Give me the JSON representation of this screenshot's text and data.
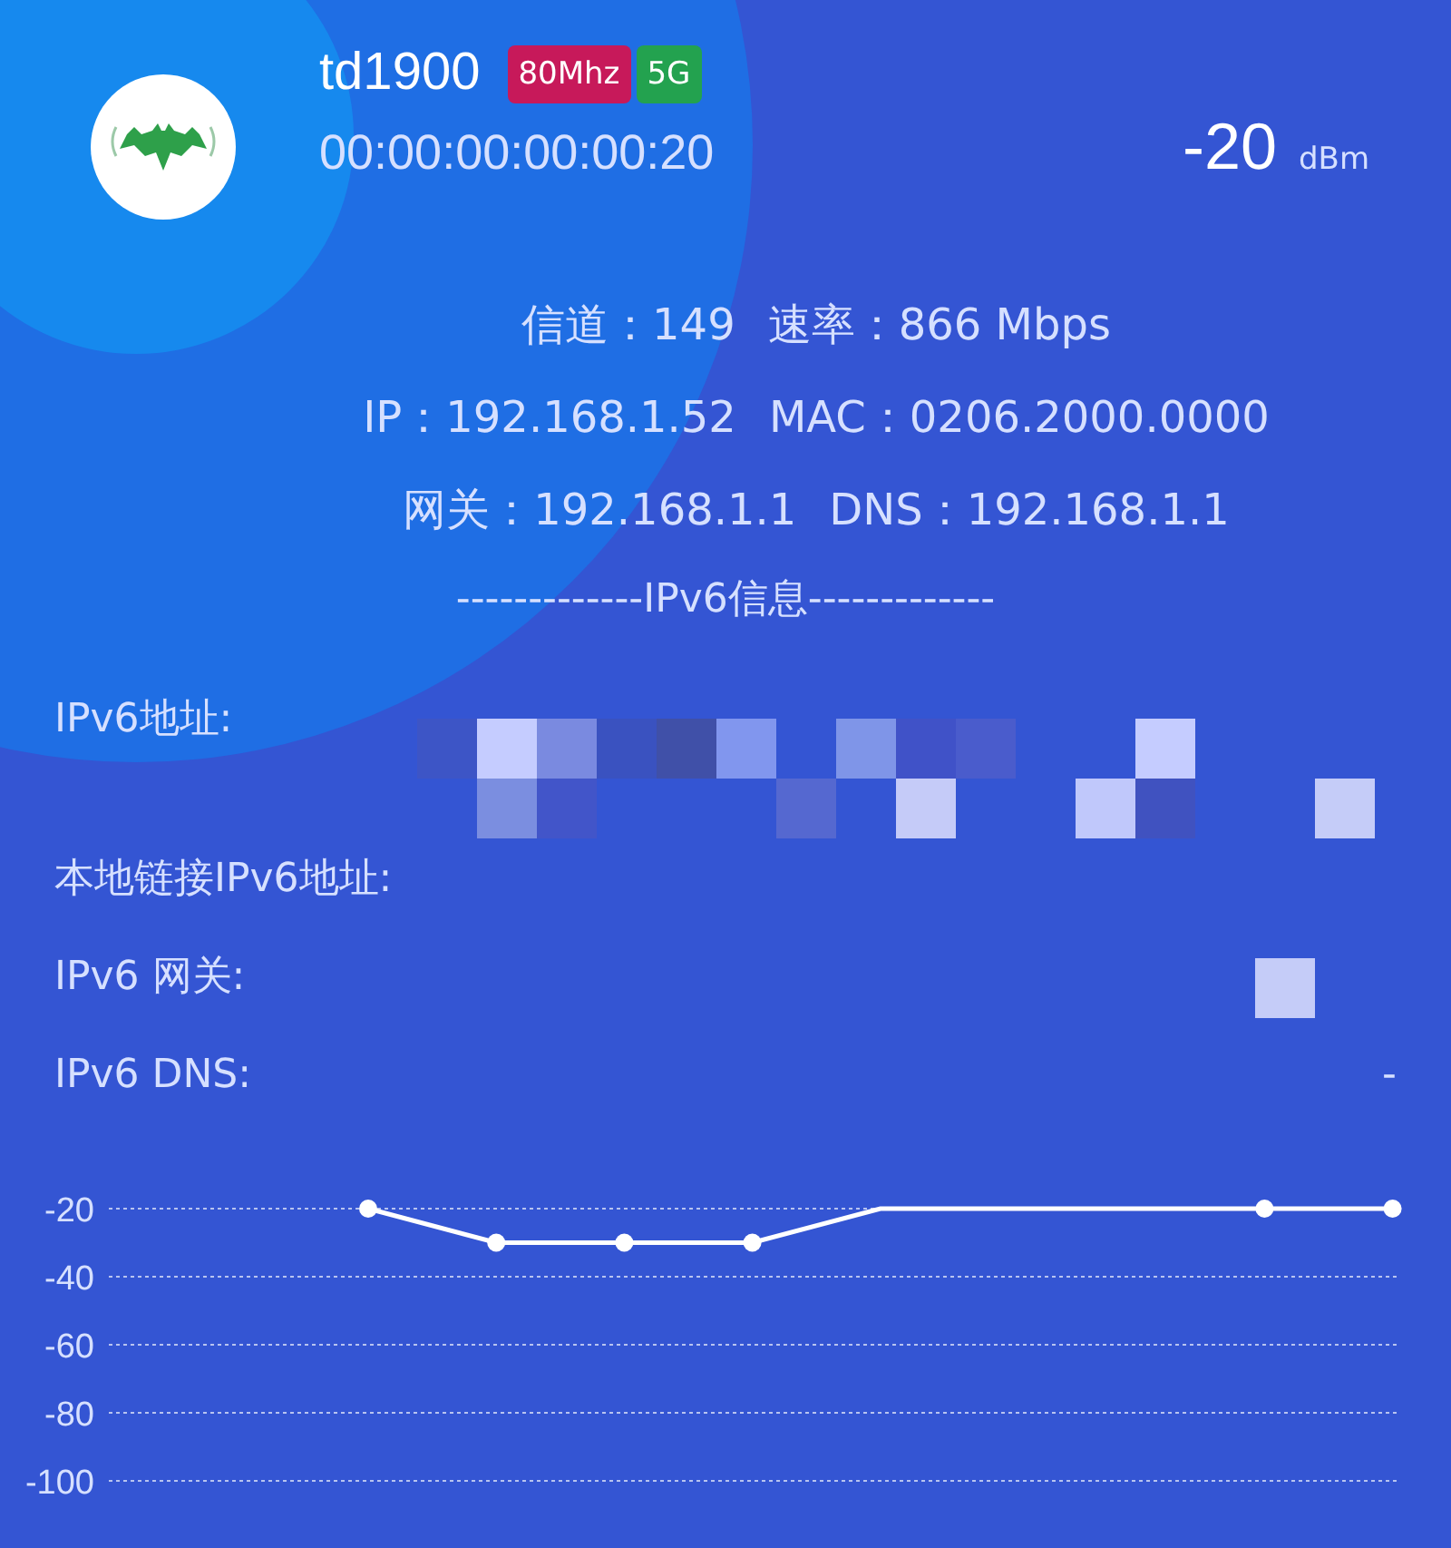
{
  "device": {
    "name": "td1900",
    "badges": [
      {
        "text": "80Mhz",
        "color": "#c7195a"
      },
      {
        "text": "5G",
        "color": "#23a24f"
      }
    ],
    "mac": "00:00:00:00:00:20",
    "signal": "-20",
    "signal_unit": "dBm"
  },
  "info_rows": [
    [
      {
        "label": "信道：",
        "value": "149"
      },
      {
        "label": "速率：",
        "value": "866 Mbps"
      }
    ],
    [
      {
        "label": "IP：",
        "value": "192.168.1.52"
      },
      {
        "label": "MAC：",
        "value": "0206.2000.0000"
      }
    ],
    [
      {
        "label": "网关：",
        "value": "192.168.1.1"
      },
      {
        "label": "DNS：",
        "value": "192.168.1.1"
      }
    ]
  ],
  "ipv6_heading": "-------------IPv6信息-------------",
  "ipv6_fields": [
    {
      "label": "IPv6地址:"
    },
    {
      "label": "本地链接IPv6地址:"
    },
    {
      "label": "IPv6 网关:"
    },
    {
      "label": "IPv6 DNS:",
      "value": "-"
    }
  ],
  "chart": {
    "chart_data": {
      "type": "line",
      "grid": true,
      "ylim": [
        -100,
        -20
      ],
      "yticks": [
        -20,
        -40,
        -60,
        -80,
        -100
      ],
      "series": [
        {
          "color": "#ffffff",
          "values": [
            -20,
            -30,
            -30,
            -30,
            -20,
            -20,
            -20,
            -20,
            -20
          ]
        }
      ]
    }
  }
}
